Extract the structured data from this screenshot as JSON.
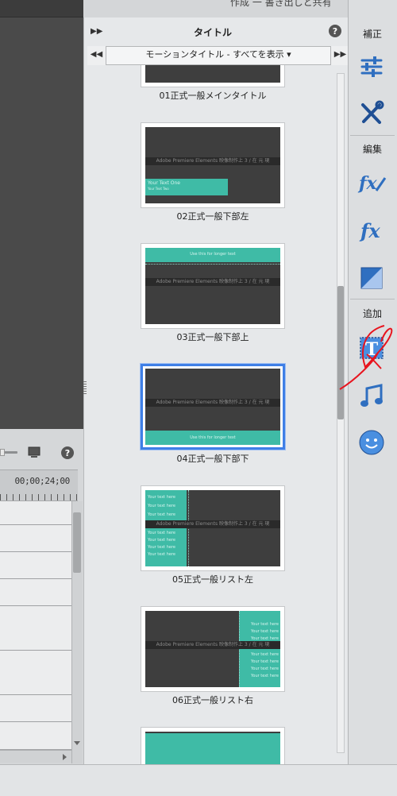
{
  "top": {
    "overflow_text": "作成 一 書き出しと共有"
  },
  "preview": {
    "timecode": "00;00;24;00"
  },
  "panel": {
    "title": "タイトル",
    "filter_prev": "◀◀",
    "filter_next": "▶▶",
    "collapse": "▶▶",
    "filter_label": "モーションタイトル - すべてを表示 ▾"
  },
  "thumbnails": [
    {
      "caption": "01正式一般メインタイトル"
    },
    {
      "caption": "02正式一般下部左",
      "band": "Adobe Premiere Elements 映像制作上 3 / 在 元 現",
      "text": "Your Text One",
      "subtext": "Your Text Two"
    },
    {
      "caption": "03正式一般下部上",
      "band": "Adobe Premiere Elements 映像制作上 3 / 在 元 現",
      "text": "Use this for longer text"
    },
    {
      "caption": "04正式一般下部下",
      "band": "Adobe Premiere Elements 映像制作上 3 / 在 元 現",
      "text": "Use this for longer text",
      "selected": true
    },
    {
      "caption": "05正式一般リスト左",
      "band": "Adobe Premiere Elements 映像制作上 3 / 在 元 現",
      "list": [
        "Your text here",
        "Your text here",
        "Your text here",
        "Your text here",
        "Your text here",
        "Your text here",
        "Your text here"
      ]
    },
    {
      "caption": "06正式一般リスト右",
      "band": "Adobe Premiere Elements 映像制作上 3 / 在 元 現",
      "list": [
        "Your text here",
        "Your text here",
        "Your text here",
        "Your text here",
        "Your text here",
        "Your text here",
        "Your text here"
      ]
    },
    {
      "caption": ""
    }
  ],
  "rightbar": {
    "section_adjust": "補正",
    "section_edit": "編集",
    "section_add": "追加",
    "buttons": [
      "adjust-sliders-icon",
      "tools-icon",
      "fx-applied-icon",
      "fx-effects-icon",
      "transitions-icon",
      "titles-icon",
      "music-icon",
      "graphics-icon"
    ]
  },
  "colors": {
    "accent_teal": "#3fbba6",
    "selection_blue": "#3f7fe6",
    "annotation_red": "#e8141e",
    "icon_blue": "#2f6fc0"
  }
}
